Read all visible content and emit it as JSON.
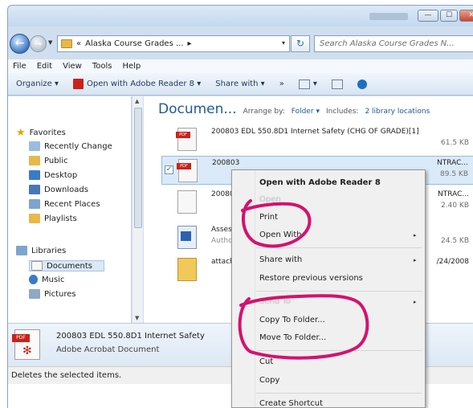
{
  "window": {
    "title_blurred": "Ilana Freedman",
    "buttons": {
      "min": "—",
      "max": "☐",
      "close": "✕"
    }
  },
  "address": {
    "path_prefix": "«",
    "path_text": "Alaska Course Grades ...",
    "path_arrow": "▸",
    "dropdown": "▾",
    "refresh": "↻",
    "search_placeholder": "Search Alaska Course Grades N..."
  },
  "menubar": [
    "File",
    "Edit",
    "View",
    "Tools",
    "Help"
  ],
  "toolbar": {
    "organize": "Organize ▾",
    "open_with": "Open with Adobe Reader 8 ▾",
    "share_with": "Share with ▾",
    "more": "»",
    "views": "▾"
  },
  "nav_pane": {
    "favorites_label": "Favorites",
    "favorites": [
      "Recently Change",
      "Public",
      "Desktop",
      "Downloads",
      "Recent Places",
      "Playlists"
    ],
    "libraries_label": "Libraries",
    "libraries": [
      "Documents",
      "Music",
      "Pictures"
    ]
  },
  "content": {
    "title": "Documen...",
    "arrange_by": "Arrange by:",
    "arrange_value": "Folder ▾",
    "includes": "Includes:",
    "includes_value": "2 library locations",
    "files": [
      {
        "name": "200803 EDL 550.8D1 Internet Safety (CHG OF GRADE)[1]",
        "size": "61.5 KB",
        "right": ""
      },
      {
        "name": "200803",
        "size": "89.5 KB",
        "right": "NTRAC..."
      },
      {
        "name": "200803",
        "size": "2.40 KB",
        "right": "NTRAC..."
      },
      {
        "name": "Assess",
        "sub": "Autho",
        "size": "24.5 KB",
        "right": ""
      },
      {
        "name": "attach",
        "size": "",
        "right": "/24/2008"
      }
    ],
    "checkbox": "✓"
  },
  "details": {
    "name": "200803 EDL 550.8D1 Internet Safety",
    "type": "Adobe Acrobat Document",
    "pdf_badge": "PDF"
  },
  "status": "Deletes the selected items.",
  "context_menu": {
    "open_with_reader": "Open with Adobe Reader 8",
    "open": "Open",
    "print": "Print",
    "open_with": "Open With",
    "share_with": "Share with",
    "restore": "Restore previous versions",
    "send_to": "Send To",
    "copy_to": "Copy To Folder...",
    "move_to": "Move To Folder...",
    "cut": "Cut",
    "copy": "Copy",
    "create_shortcut": "Create Shortcut",
    "submenu_arrow": "▸"
  },
  "colors": {
    "annotation": "#d4126e",
    "link_blue": "#1e5a96",
    "pdf_red": "#c8231a"
  }
}
